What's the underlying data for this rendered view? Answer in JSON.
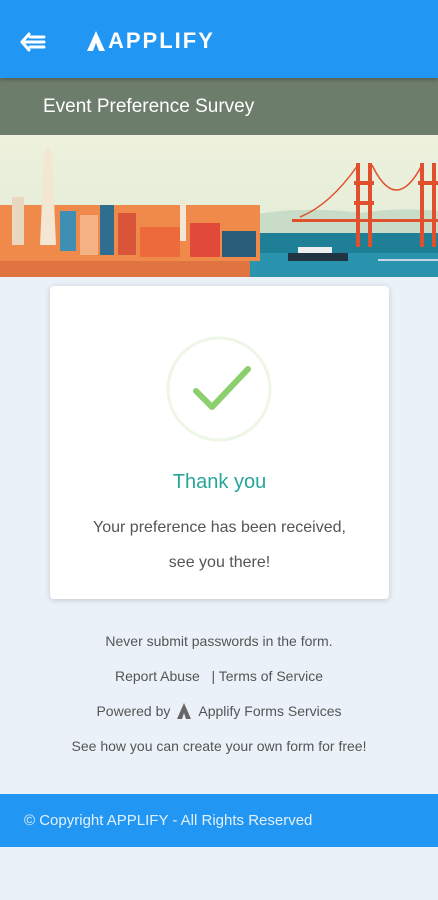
{
  "appbar": {
    "back_icon": "back-arrow-icon",
    "logo_text": "APPLIFY",
    "brand_color": "#2196f3"
  },
  "survey": {
    "title": "Event Preference Survey",
    "banner": "san-francisco-skyline-illustration"
  },
  "confirmation": {
    "icon": "checkmark-icon",
    "heading": "Thank you",
    "message_line1": "Your preference has been received,",
    "message_line2": "see you there!",
    "accent_color": "#26a69a"
  },
  "footer": {
    "warning": "Never submit passwords in the form.",
    "report_abuse": "Report Abuse",
    "separator": "|",
    "terms": "Terms of Service",
    "powered_by": "Powered by",
    "powered_service": "Applify Forms Services",
    "cta": "See how you can create your own form for free!",
    "copyright": "© Copyright  APPLIFY - All Rights Reserved"
  }
}
